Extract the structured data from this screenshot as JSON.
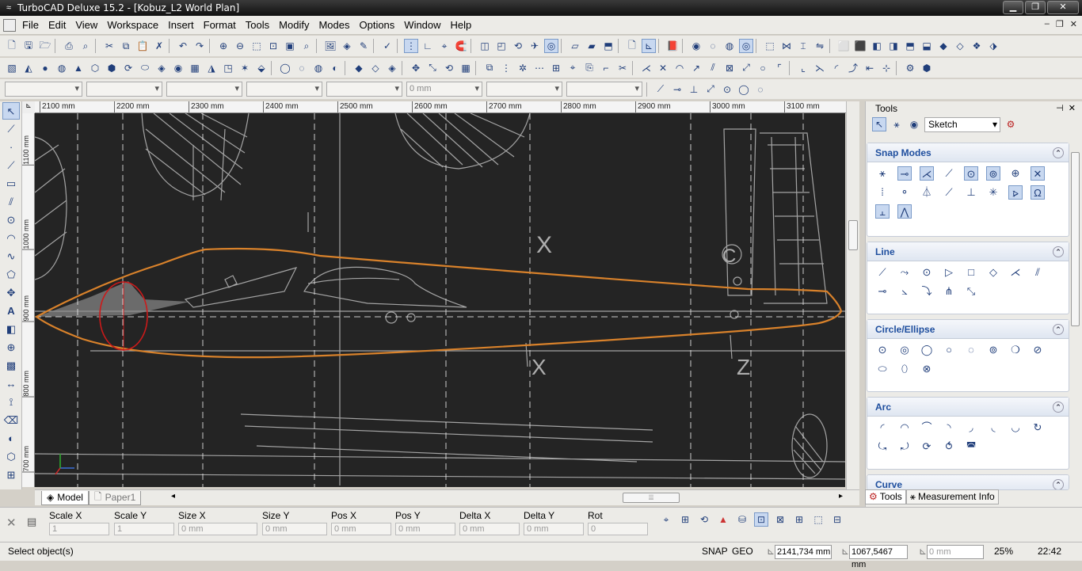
{
  "window": {
    "title": "TurboCAD Deluxe 15.2 - [Kobuz_L2 World Plan]",
    "app_icon": "turbocad-icon",
    "controls": [
      "minimize-icon",
      "restore-icon",
      "close-icon"
    ]
  },
  "menu": {
    "items": [
      "File",
      "Edit",
      "View",
      "Workspace",
      "Insert",
      "Format",
      "Tools",
      "Modify",
      "Modes",
      "Options",
      "Window",
      "Help"
    ]
  },
  "prop_toolbar": {
    "length_value": "0 mm"
  },
  "rulers": {
    "h_ticks": [
      "2100 mm",
      "2200 mm",
      "2300 mm",
      "2400 mm",
      "2500 mm",
      "2600 mm",
      "2700 mm",
      "2800 mm",
      "2900 mm",
      "3000 mm",
      "3100 mm"
    ],
    "v_ticks": [
      "1100 mm",
      "1000 mm",
      "900 mm",
      "800 mm",
      "700 mm"
    ]
  },
  "tabs": {
    "model": "Model",
    "paper": "Paper1"
  },
  "inspector": {
    "fields": [
      {
        "label": "Scale X",
        "value": "1"
      },
      {
        "label": "Scale Y",
        "value": "1"
      },
      {
        "label": "Size X",
        "value": "0 mm"
      },
      {
        "label": "Size Y",
        "value": "0 mm"
      },
      {
        "label": "Pos X",
        "value": "0 mm"
      },
      {
        "label": "Pos Y",
        "value": "0 mm"
      },
      {
        "label": "Delta X",
        "value": "0 mm"
      },
      {
        "label": "Delta Y",
        "value": "0 mm"
      },
      {
        "label": "Rot",
        "value": "0"
      }
    ]
  },
  "status": {
    "prompt": "Select object(s)",
    "snap": "SNAP",
    "geo": "GEO",
    "x": "2141,734 mm",
    "y": "1067,5467 mm",
    "z": "0 mm",
    "zoom": "25%",
    "time": "22:42"
  },
  "panel": {
    "title": "Tools",
    "sketch": "Sketch",
    "groups": [
      {
        "name": "Snap Modes"
      },
      {
        "name": "Line"
      },
      {
        "name": "Circle/Ellipse"
      },
      {
        "name": "Arc"
      },
      {
        "name": "Curve"
      }
    ],
    "tabs": [
      "Tools",
      "Measurement Info"
    ]
  },
  "drawing": {
    "background": "#242424",
    "line_color": "#cfcfcf",
    "outline_color": "#d9822b",
    "selection_color": "#cc1a1a",
    "labels": [
      "X",
      "X",
      "C",
      "Z"
    ]
  }
}
